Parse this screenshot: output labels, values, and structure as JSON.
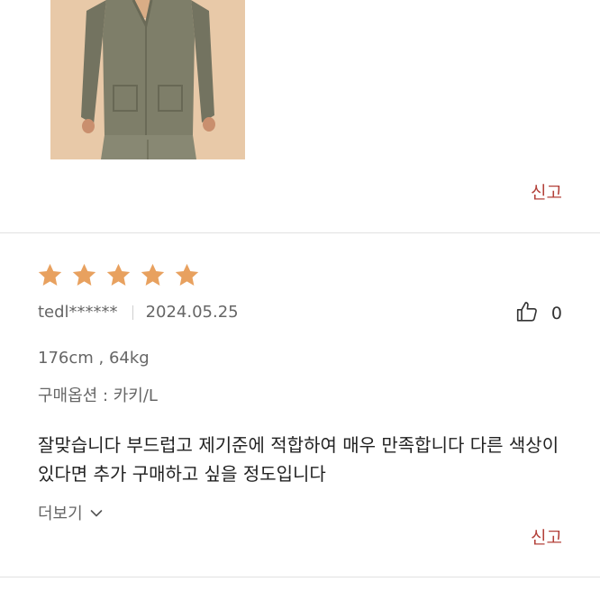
{
  "review_top": {
    "report_label": "신고"
  },
  "review": {
    "rating": 5,
    "rating_max": 5,
    "star_color": "#e8a15f",
    "username": "tedl******",
    "date": "2024.05.25",
    "like_count": "0",
    "body_info": "176cm , 64kg",
    "purchase_option": "구매옵션 : 카키/L",
    "text": "잘맞습니다 부드럽고 제기준에 적합하여 매우 만족합니다 다른 색상이 있다면 추가 구매하고 싶을 정도입니다",
    "more_label": "더보기",
    "report_label": "신고"
  },
  "colors": {
    "report": "#b3413a",
    "divider": "#e1e1e1",
    "photo_background": "#e8c9a8",
    "garment": "#7d7d68"
  },
  "icons": {
    "like": "thumbs-up-icon",
    "more": "chevron-down-icon",
    "star": "star-icon"
  }
}
